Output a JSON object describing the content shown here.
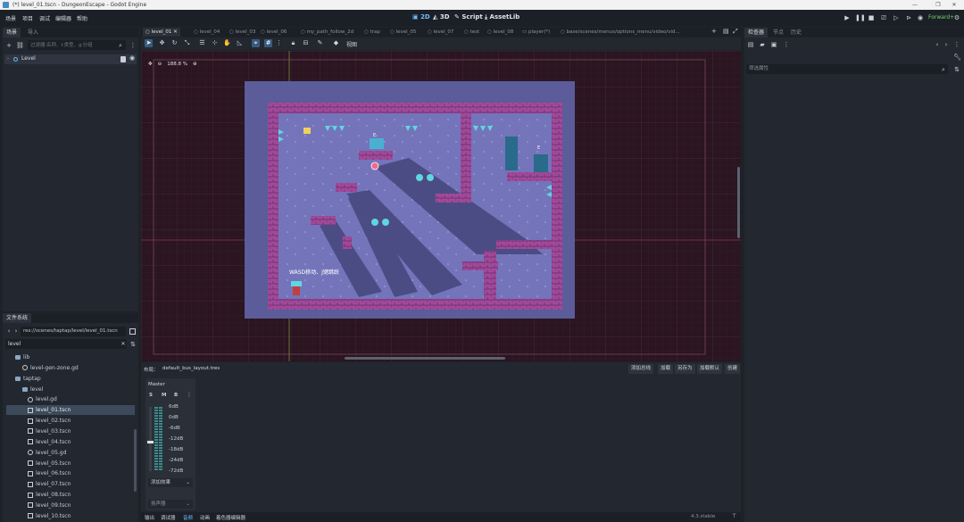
{
  "window": {
    "title": "(*) level_01.tscn - DungeonEscape - Godot Engine"
  },
  "menu": [
    "场景",
    "项目",
    "调试",
    "编辑器",
    "帮助"
  ],
  "modes": {
    "m2d": "2D",
    "m3d": "3D",
    "script": "Script",
    "assetlib": "AssetLib"
  },
  "renderer": "Forward+",
  "scene_dock": {
    "tabs": [
      "场景",
      "导入"
    ],
    "filter_placeholder": "过滤器:名称、t:类型、g:分组",
    "root_node": "Level"
  },
  "filesystem": {
    "tab": "文件系统",
    "path": "res://scenes/taptap/level/level_01.tscn",
    "search": "level",
    "items": [
      {
        "label": "lib",
        "type": "folder"
      },
      {
        "label": "level-gen-zone.gd",
        "type": "gear"
      },
      {
        "label": "taptap",
        "type": "folder"
      },
      {
        "label": "level",
        "type": "folder"
      },
      {
        "label": "level.gd",
        "type": "gear"
      },
      {
        "label": "level_01.tscn",
        "type": "scene"
      },
      {
        "label": "level_02.tscn",
        "type": "scene"
      },
      {
        "label": "level_03.tscn",
        "type": "scene"
      },
      {
        "label": "level_04.tscn",
        "type": "scene"
      },
      {
        "label": "level_05.gd",
        "type": "gear"
      },
      {
        "label": "level_05.tscn",
        "type": "scene"
      },
      {
        "label": "level_06.tscn",
        "type": "scene"
      },
      {
        "label": "level_07.tscn",
        "type": "scene"
      },
      {
        "label": "level_08.tscn",
        "type": "scene"
      },
      {
        "label": "level_09.tscn",
        "type": "scene"
      },
      {
        "label": "level_10.tscn",
        "type": "scene"
      }
    ]
  },
  "scene_tabs": [
    "level_01",
    "level_04",
    "level_03",
    "level_06",
    "my_path_follow_2d",
    "trap",
    "level_05",
    "level_07",
    "test",
    "level_08",
    "player(*)",
    "base/scenes/menus/options_menu/video/vid..."
  ],
  "viewport": {
    "zoom": "188.8 %",
    "view_menu": "视图",
    "hint_text": "WASD移动、J键跳跃",
    "door_label": "E"
  },
  "audio": {
    "layout_label": "布局：",
    "layout_file": "default_bus_layout.tres",
    "buttons": [
      "添加总线",
      "加载",
      "另存为",
      "加载默认",
      "创建"
    ],
    "bus_name": "Master",
    "smb": [
      "S",
      "M",
      "B"
    ],
    "db_labels": [
      "6dB",
      "0dB",
      "-6dB",
      "-12dB",
      "-18dB",
      "-24dB",
      "-72dB"
    ],
    "add_effect": "添加效果",
    "output": "扬声器"
  },
  "bottom_tabs": [
    "输出",
    "调试器",
    "音频",
    "动画",
    "着色器编辑器"
  ],
  "version": "4.3.stable",
  "inspector": {
    "tabs": [
      "检查器",
      "节点",
      "历史"
    ],
    "filter": "筛选属性"
  },
  "colors": {
    "accent": "#6bbcff",
    "canvas_bg": "#2a1520",
    "room_bg": "#7070b8",
    "brick": "#a04a9a"
  }
}
